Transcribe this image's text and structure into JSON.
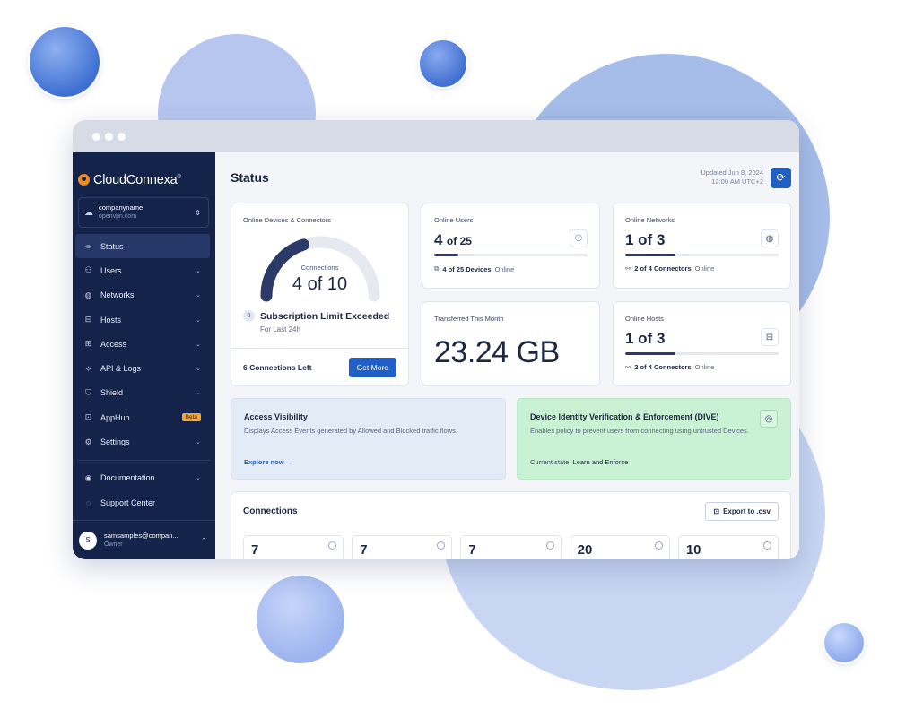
{
  "colors": {
    "sidebar": "#14234a",
    "accent": "#1f5fc6",
    "dive_panel": "#c9f2d4",
    "access_panel": "#e3ebf7"
  },
  "brand": {
    "name": "CloudConnexa",
    "trademark": "®"
  },
  "org": {
    "name": "companyname",
    "domain": "openvpn.com",
    "icon": "cloud-icon"
  },
  "sidebar": {
    "items": [
      {
        "label": "Status",
        "icon": "status-icon",
        "glyph": "⌯",
        "chevron": false,
        "active": true
      },
      {
        "label": "Users",
        "icon": "users-icon",
        "glyph": "⚇",
        "chevron": true
      },
      {
        "label": "Networks",
        "icon": "globe-icon",
        "glyph": "◍",
        "chevron": true
      },
      {
        "label": "Hosts",
        "icon": "hosts-icon",
        "glyph": "⊟",
        "chevron": true
      },
      {
        "label": "Access",
        "icon": "access-icon",
        "glyph": "⊞",
        "chevron": true
      },
      {
        "label": "API & Logs",
        "icon": "api-icon",
        "glyph": "⟡",
        "chevron": true
      },
      {
        "label": "Shield",
        "icon": "shield-icon",
        "glyph": "⛉",
        "chevron": true
      },
      {
        "label": "AppHub",
        "icon": "apphub-icon",
        "glyph": "⊡",
        "chevron": false,
        "badge": "Beta"
      },
      {
        "label": "Settings",
        "icon": "gear-icon",
        "glyph": "⚙",
        "chevron": true
      }
    ],
    "secondary": [
      {
        "label": "Documentation",
        "icon": "documentation-icon",
        "glyph": "◉",
        "chevron": true
      },
      {
        "label": "Support Center",
        "icon": "support-icon",
        "glyph": "◌",
        "chevron": false
      }
    ],
    "user": {
      "initial": "S",
      "email": "samsamples@compan...",
      "role": "Owner"
    }
  },
  "header": {
    "title": "Status",
    "updated_line1": "Updated Jun 8, 2024",
    "updated_line2": "12:00 AM UTC+2"
  },
  "devices_card": {
    "label": "Online Devices & Connectors",
    "gauge_caption": "Connections",
    "gauge_value": "4 of 10",
    "gauge_used": 4,
    "gauge_total": 10,
    "limit_badge": "0",
    "limit_title": "Subscription Limit Exceeded",
    "limit_sub": "For Last 24h",
    "connections_left": "6 Connections Left",
    "button": "Get More"
  },
  "users_card": {
    "label": "Online Users",
    "value": "4",
    "of": "of 25",
    "progress": 0.16,
    "foot_bold": "4 of 25 Devices",
    "foot_rest": "Online"
  },
  "networks_card": {
    "label": "Online Networks",
    "value": "1 of 3",
    "progress": 0.33,
    "foot_bold": "2 of 4 Connectors",
    "foot_rest": "Online"
  },
  "transfer_card": {
    "label": "Transferred This Month",
    "value": "23.24 GB"
  },
  "hosts_card": {
    "label": "Online Hosts",
    "value": "1 of 3",
    "progress": 0.33,
    "foot_bold": "2 of 4 Connectors",
    "foot_rest": "Online"
  },
  "access_panel": {
    "title": "Access Visibility",
    "desc": "Displays Access Events generated by Allowed and Blocked traffic flows.",
    "link": "Explore now →"
  },
  "dive_panel": {
    "title": "Device Identity Verification & Enforcement (DIVE)",
    "desc": "Enables policy to prevent users from connecting using untrusted Devices.",
    "state_label": "Current state:",
    "state_value": "Learn and Enforce"
  },
  "connections": {
    "title": "Connections",
    "export": "Export to .csv",
    "tiles": [
      "7",
      "7",
      "7",
      "20",
      "10"
    ]
  }
}
